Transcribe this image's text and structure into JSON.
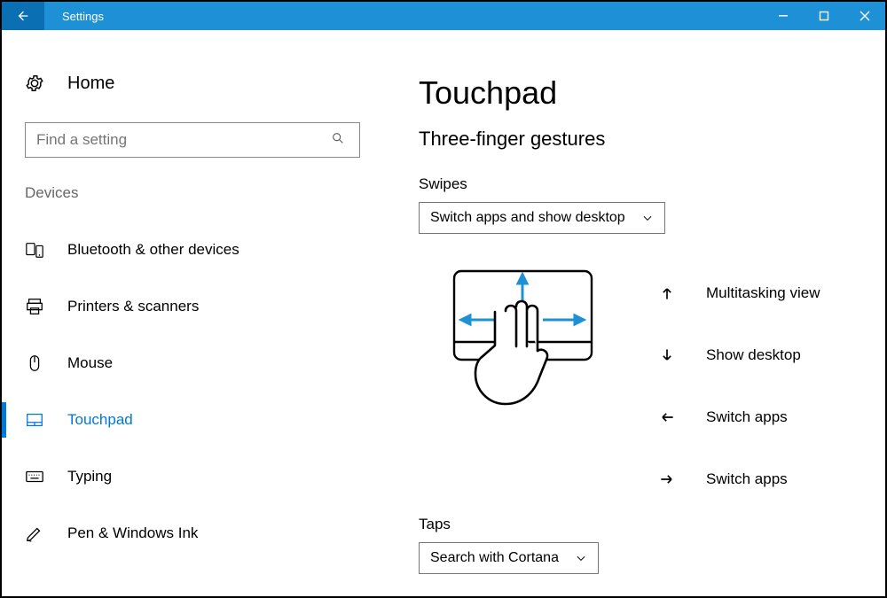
{
  "window": {
    "title": "Settings"
  },
  "sidebar": {
    "home_label": "Home",
    "search_placeholder": "Find a setting",
    "group_header": "Devices",
    "items": [
      {
        "label": "Bluetooth & other devices",
        "icon": "bluetooth-devices-icon"
      },
      {
        "label": "Printers & scanners",
        "icon": "printer-icon"
      },
      {
        "label": "Mouse",
        "icon": "mouse-icon"
      },
      {
        "label": "Touchpad",
        "icon": "touchpad-icon"
      },
      {
        "label": "Typing",
        "icon": "keyboard-icon"
      },
      {
        "label": "Pen & Windows Ink",
        "icon": "pen-icon"
      }
    ],
    "active_index": 3
  },
  "page": {
    "title": "Touchpad",
    "section": "Three-finger gestures",
    "swipes_label": "Swipes",
    "swipes_value": "Switch apps and show desktop",
    "taps_label": "Taps",
    "taps_value": "Search with Cortana",
    "gesture_map": [
      {
        "dir": "up",
        "label": "Multitasking view"
      },
      {
        "dir": "down",
        "label": "Show desktop"
      },
      {
        "dir": "left",
        "label": "Switch apps"
      },
      {
        "dir": "right",
        "label": "Switch apps"
      }
    ]
  },
  "colors": {
    "accent": "#0078d7",
    "header": "#1e90d6",
    "header_back": "#0a6fb3"
  }
}
